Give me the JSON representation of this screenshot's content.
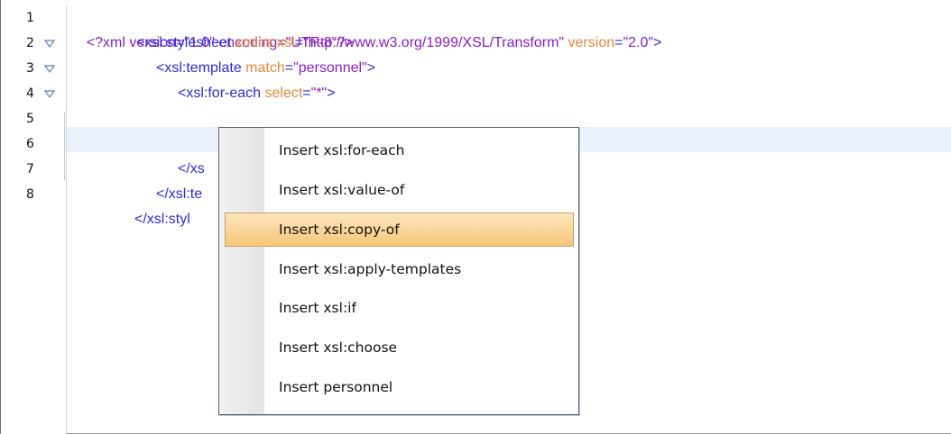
{
  "editor": {
    "line_numbers": [
      "1",
      "2",
      "3",
      "4",
      "5",
      "6",
      "7",
      "8"
    ],
    "fold_icon": "triangle-down-icon",
    "lines": {
      "l1": "<?xml version=\"1.0\" encoding=\"UTF-8\"?>",
      "l2": {
        "open": "<xsl:stylesheet",
        "a1_name": "xmlns:xsl",
        "a1_eq": "=",
        "a1_value": "\"http://www.w3.org/1999/XSL/Transform\"",
        "a2_name": "version",
        "a2_eq": "=",
        "a2_value": "\"2.0\"",
        "close": ">"
      },
      "l3": {
        "open": "<xsl:template",
        "a1_name": "match",
        "a1_eq": "=",
        "a1_value": "\"personnel\"",
        "close": ">"
      },
      "l4": {
        "open": "<xsl:for-each",
        "a1_name": "select",
        "a1_eq": "=",
        "a1_value": "\"*\"",
        "close": ">"
      },
      "l6": "</xs",
      "l7": "</xsl:te",
      "l8": "</xsl:styl"
    }
  },
  "popup": {
    "items": [
      "Insert  xsl:for-each",
      "Insert  xsl:value-of",
      "Insert  xsl:copy-of",
      "Insert  xsl:apply-templates",
      "Insert  xsl:if",
      "Insert  xsl:choose",
      "Insert  personnel"
    ],
    "selected_index": 2
  },
  "colors": {
    "tag": "#8a1ec2",
    "attribute": "#e28a3b",
    "value": "#8a1ec2",
    "current_line": "#eaf2fb",
    "selection": "#f7c67a"
  }
}
